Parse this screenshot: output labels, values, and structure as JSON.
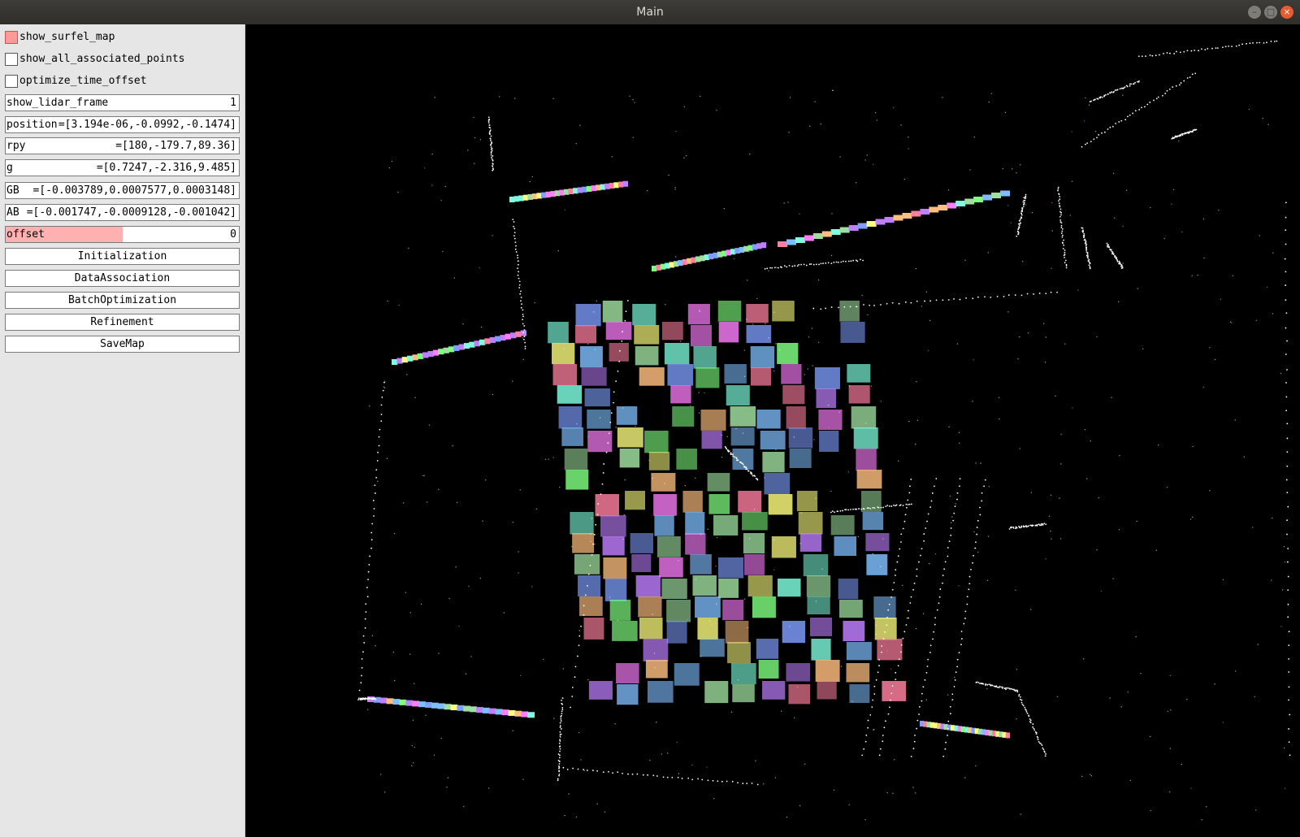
{
  "window": {
    "title": "Main",
    "minimize_icon": "minimize-icon",
    "maximize_icon": "maximize-icon",
    "close_icon": "close-icon",
    "min_glyph": "–",
    "max_glyph": "□",
    "close_glyph": "×"
  },
  "panel": {
    "checkboxes": [
      {
        "label": "show_surfel_map",
        "checked": true
      },
      {
        "label": "show_all_associated_points",
        "checked": false
      },
      {
        "label": "optimize_time_offset",
        "checked": false
      }
    ],
    "fields": {
      "show_lidar_frame": {
        "name": "show_lidar_frame",
        "value": "1"
      },
      "position": {
        "name": "position",
        "value": "=[3.194e-06,-0.0992,-0.1474]"
      },
      "rpy": {
        "name": "rpy",
        "value": "=[180,-179.7,89.36]"
      },
      "g": {
        "name": "g",
        "value": "=[0.7247,-2.316,9.485]"
      },
      "gb": {
        "name": "GB",
        "value": "=[-0.003789,0.0007577,0.0003148]"
      },
      "ab": {
        "name": "AB",
        "value": "=[-0.001747,-0.0009128,-0.001042]"
      },
      "offset": {
        "name": "offset",
        "value": "0",
        "fill_fraction": 0.5
      }
    },
    "buttons": {
      "initialization": "Initialization",
      "data_association": "DataAssociation",
      "batch_optimization": "BatchOptimization",
      "refinement": "Refinement",
      "save_map": "SaveMap"
    }
  },
  "viewport": {
    "background": "#000000",
    "surfel_palette": [
      "#ff7fa0",
      "#7fff7f",
      "#7fbfff",
      "#ffbf7f",
      "#bf7fff",
      "#7fffdf",
      "#ffff7f",
      "#ff7fff",
      "#9fdf9f",
      "#7f9fff"
    ],
    "point_color": "#ffffff"
  }
}
